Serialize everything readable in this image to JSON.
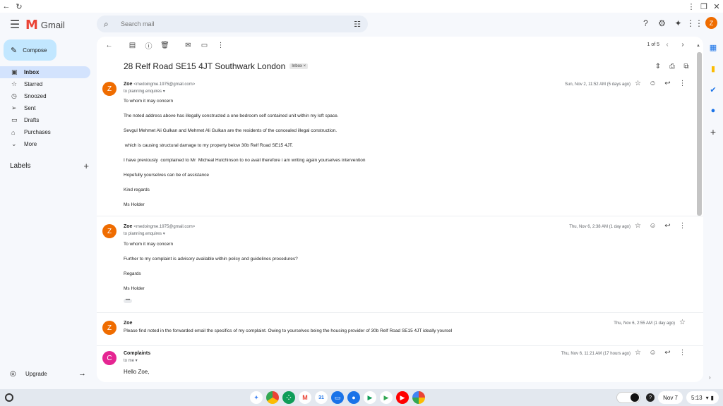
{
  "chrome": {
    "back": "←",
    "reload": "↻",
    "menu": "⋮",
    "restore": "❐",
    "close": "✕"
  },
  "header": {
    "app_name": "Gmail",
    "search_placeholder": "Search mail",
    "avatar_letter": "Z"
  },
  "sidebar": {
    "compose_label": "Compose",
    "items": [
      {
        "label": "Inbox",
        "icon": "inbox-icon",
        "glyph": "▣"
      },
      {
        "label": "Starred",
        "icon": "star-icon",
        "glyph": "☆"
      },
      {
        "label": "Snoozed",
        "icon": "clock-icon",
        "glyph": "◷"
      },
      {
        "label": "Sent",
        "icon": "send-icon",
        "glyph": "➢"
      },
      {
        "label": "Drafts",
        "icon": "draft-icon",
        "glyph": "▭"
      },
      {
        "label": "Purchases",
        "icon": "tag-icon",
        "glyph": "⌂"
      },
      {
        "label": "More",
        "icon": "chevron-down-icon",
        "glyph": "⌄"
      }
    ],
    "labels_heading": "Labels",
    "upgrade_label": "Upgrade"
  },
  "toolbar": {
    "pager": "1 of 5"
  },
  "thread": {
    "subject": "28 Relf Road SE15 4JT Southwark London",
    "badge": "Inbox ×",
    "messages": [
      {
        "avatar": "Z",
        "sender": "Zoe",
        "email": "<medoingme.1975@gmail.com>",
        "to": "to planning.enquires ▾",
        "date": "Sun, Nov 2, 11:52 AM (5 days ago)",
        "body": [
          "To whom it may concern",
          "The noted address above has illegally constructed a one bedroom self contained unit within my loft space.",
          "Sevgul Mehmet Ali Gulkan and Mehmet Ali Gulkan are the residents of the concealed illegal construction.",
          " which is causing structural damage to my property below 30b Relf Road SE15 4JT.",
          "I have previously  complained to Mr  Micheal Hutchinson to no avail therefore i am writing again yourselves intervention",
          "Hopefully yourselves can be of assistance",
          "Kind regards",
          "Ms Holder"
        ]
      },
      {
        "avatar": "Z",
        "sender": "Zoe",
        "email": "<medoingme.1975@gmail.com>",
        "to": "to planning.enquires ▾",
        "date": "Thu, Nov 6, 2:38 AM (1 day ago)",
        "body": [
          "To whom it may concern",
          "Further to my complaint is advisory available within policy and guidelines procedures?",
          "Regards",
          "Ms Holder"
        ],
        "trimmed": "•••"
      },
      {
        "avatar": "Z",
        "sender": "Zoe",
        "date": "Thu, Nov 6, 2:55 AM (1 day ago)",
        "snippet": "Please find noted in the forwarded email the specifics of my complaint. Owing to yourselves being the housing provider of 30b Relf Road SE15 4JT ideally yoursel"
      },
      {
        "avatar": "C",
        "sender": "Complaints",
        "to": "to me ▾",
        "date": "Thu, Nov 6, 11:21 AM (17 hours ago)",
        "greeting": "Hello Zoe,"
      }
    ]
  },
  "taskbar": {
    "date": "Nov 7",
    "time": "5:13"
  },
  "colors": {
    "accent": "#c2e7ff",
    "active_nav": "#d3e3fd",
    "avatar_z": "#ef6c00",
    "avatar_c": "#e52592"
  }
}
